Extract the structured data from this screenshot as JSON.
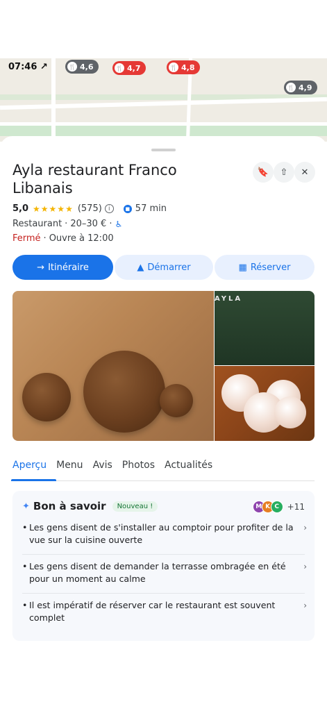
{
  "map": {
    "time": "07:46 ↗",
    "pins": [
      {
        "rating": "4,6",
        "color": "gray"
      },
      {
        "rating": "4,7",
        "color": "red"
      },
      {
        "rating": "4,8",
        "color": "red"
      },
      {
        "rating": "4,9",
        "color": "gray"
      }
    ]
  },
  "place": {
    "name": "Ayla restaurant Franco Libanais",
    "rating": "5,0",
    "stars": "★★★★★",
    "reviews_count": "(575)",
    "travel_time": "57 min",
    "category": "Restaurant",
    "price": "20–30 €",
    "status": "Fermé",
    "opens": "Ouvre à 12:00"
  },
  "actions": {
    "itinerary": "Itinéraire",
    "start": "Démarrer",
    "reserve": "Réserver"
  },
  "photos": {
    "label": "AYLA"
  },
  "tabs": [
    "Aperçu",
    "Menu",
    "Avis",
    "Photos",
    "Actualités"
  ],
  "good_to_know": {
    "title": "Bon à savoir",
    "badge": "Nouveau !",
    "avatars": [
      "M",
      "K",
      "C"
    ],
    "more": "+11",
    "tips": [
      "Les gens disent de s'installer au comptoir pour profiter de la vue sur la cuisine ouverte",
      "Les gens disent de demander la terrasse ombragée en été pour un moment au calme",
      "Il est impératif de réserver car le restaurant est souvent complet"
    ]
  },
  "colors": {
    "accent": "#1a73e8",
    "closed": "#c5221f",
    "stars": "#f4b400"
  }
}
